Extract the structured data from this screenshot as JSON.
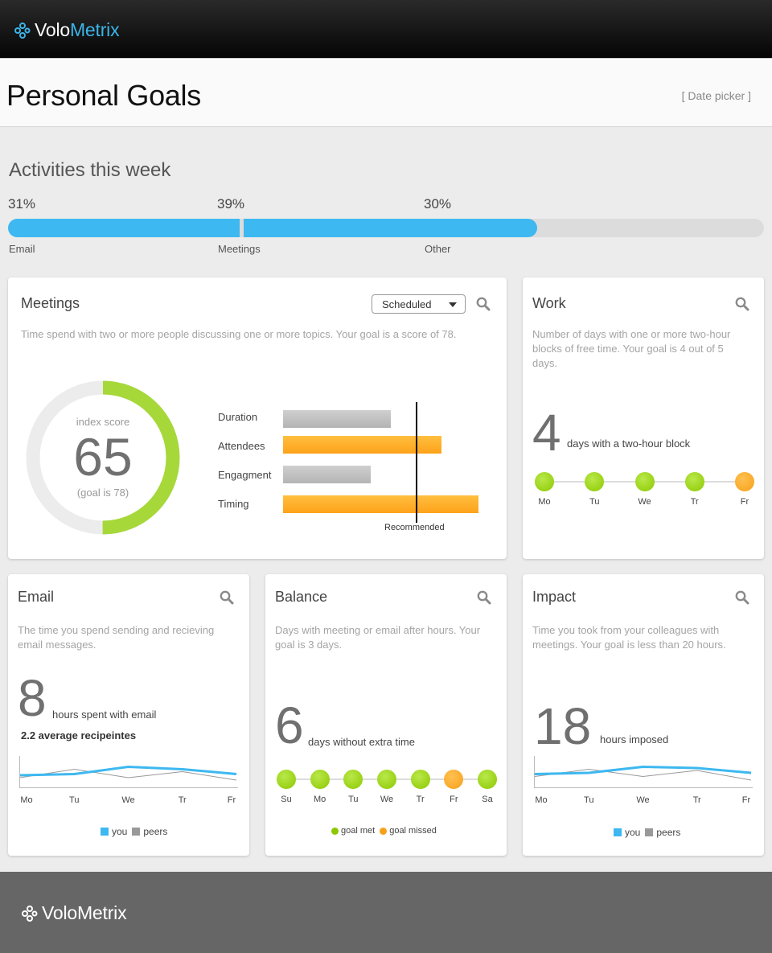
{
  "brand": {
    "name_part1": "Volo",
    "name_part2": "Metrix",
    "accent": "#3bb4e8"
  },
  "header": {
    "title": "Personal Goals",
    "date_picker": "[ Date picker ]"
  },
  "activities": {
    "title": "Activities this week",
    "segments": [
      {
        "label": "Email",
        "percent_label": "31%",
        "value": 31
      },
      {
        "label": "Meetings",
        "percent_label": "39%",
        "value": 39
      },
      {
        "label": "Other",
        "percent_label": "30%",
        "value": 30
      }
    ]
  },
  "meetings": {
    "title": "Meetings",
    "dropdown_value": "Scheduled",
    "description": "Time spend with two or more people discussing one or more topics. Your goal is a score of 78.",
    "index_label": "index score",
    "score": "65",
    "score_value": 65,
    "goal_label": "(goal is 78)",
    "recommended_label": "Recommended",
    "bars": [
      {
        "label": "Duration",
        "value": 0.55,
        "status": "gray"
      },
      {
        "label": "Attendees",
        "value": 0.81,
        "status": "orange"
      },
      {
        "label": "Engagment",
        "value": 0.45,
        "status": "gray"
      },
      {
        "label": "Timing",
        "value": 1.0,
        "status": "orange"
      }
    ],
    "recommended_value": 0.68
  },
  "work": {
    "title": "Work",
    "description": "Number of days with one or more two-hour blocks of free time. Your goal is 4 out of 5 days.",
    "number": "4",
    "caption": "days with a two-hour block",
    "days": [
      {
        "label": "Mo",
        "status": "met"
      },
      {
        "label": "Tu",
        "status": "met"
      },
      {
        "label": "We",
        "status": "met"
      },
      {
        "label": "Tr",
        "status": "met"
      },
      {
        "label": "Fr",
        "status": "missed"
      }
    ]
  },
  "email": {
    "title": "Email",
    "description": "The time you spend sending and recieving email messages.",
    "number": "8",
    "caption": "hours spent with email",
    "subcaption": "2.2 average recipeintes",
    "days": [
      "Mo",
      "Tu",
      "We",
      "Tr",
      "Fr"
    ],
    "you_values": [
      0.4,
      0.45,
      0.75,
      0.65,
      0.45
    ],
    "peer_values": [
      0.3,
      0.65,
      0.3,
      0.55,
      0.2
    ],
    "legend_you": "you",
    "legend_peers": "peers"
  },
  "balance": {
    "title": "Balance",
    "description": "Days with meeting or email after hours. Your goal is 3 days.",
    "number": "6",
    "caption": "days without extra time",
    "days": [
      {
        "label": "Su",
        "status": "met"
      },
      {
        "label": "Mo",
        "status": "met"
      },
      {
        "label": "Tu",
        "status": "met"
      },
      {
        "label": "We",
        "status": "met"
      },
      {
        "label": "Tr",
        "status": "met"
      },
      {
        "label": "Fr",
        "status": "missed"
      },
      {
        "label": "Sa",
        "status": "met"
      }
    ],
    "legend_met": "goal met",
    "legend_missed": "goal missed"
  },
  "impact": {
    "title": "Impact",
    "description": "Time you took from your colleagues with meetings. Your goal is less than 20 hours.",
    "number": "18",
    "caption": "hours imposed",
    "days": [
      "Mo",
      "Tu",
      "We",
      "Tr",
      "Fr"
    ],
    "you_values": [
      0.45,
      0.5,
      0.75,
      0.7,
      0.5
    ],
    "peer_values": [
      0.35,
      0.65,
      0.35,
      0.6,
      0.2
    ],
    "legend_you": "you",
    "legend_peers": "peers"
  },
  "colors": {
    "blue": "#3db8f0",
    "green": "#8cc800",
    "orange": "#f6a01a",
    "gray_series": "#999999",
    "donut_green": "#a6d83a",
    "donut_track": "#ececec"
  }
}
